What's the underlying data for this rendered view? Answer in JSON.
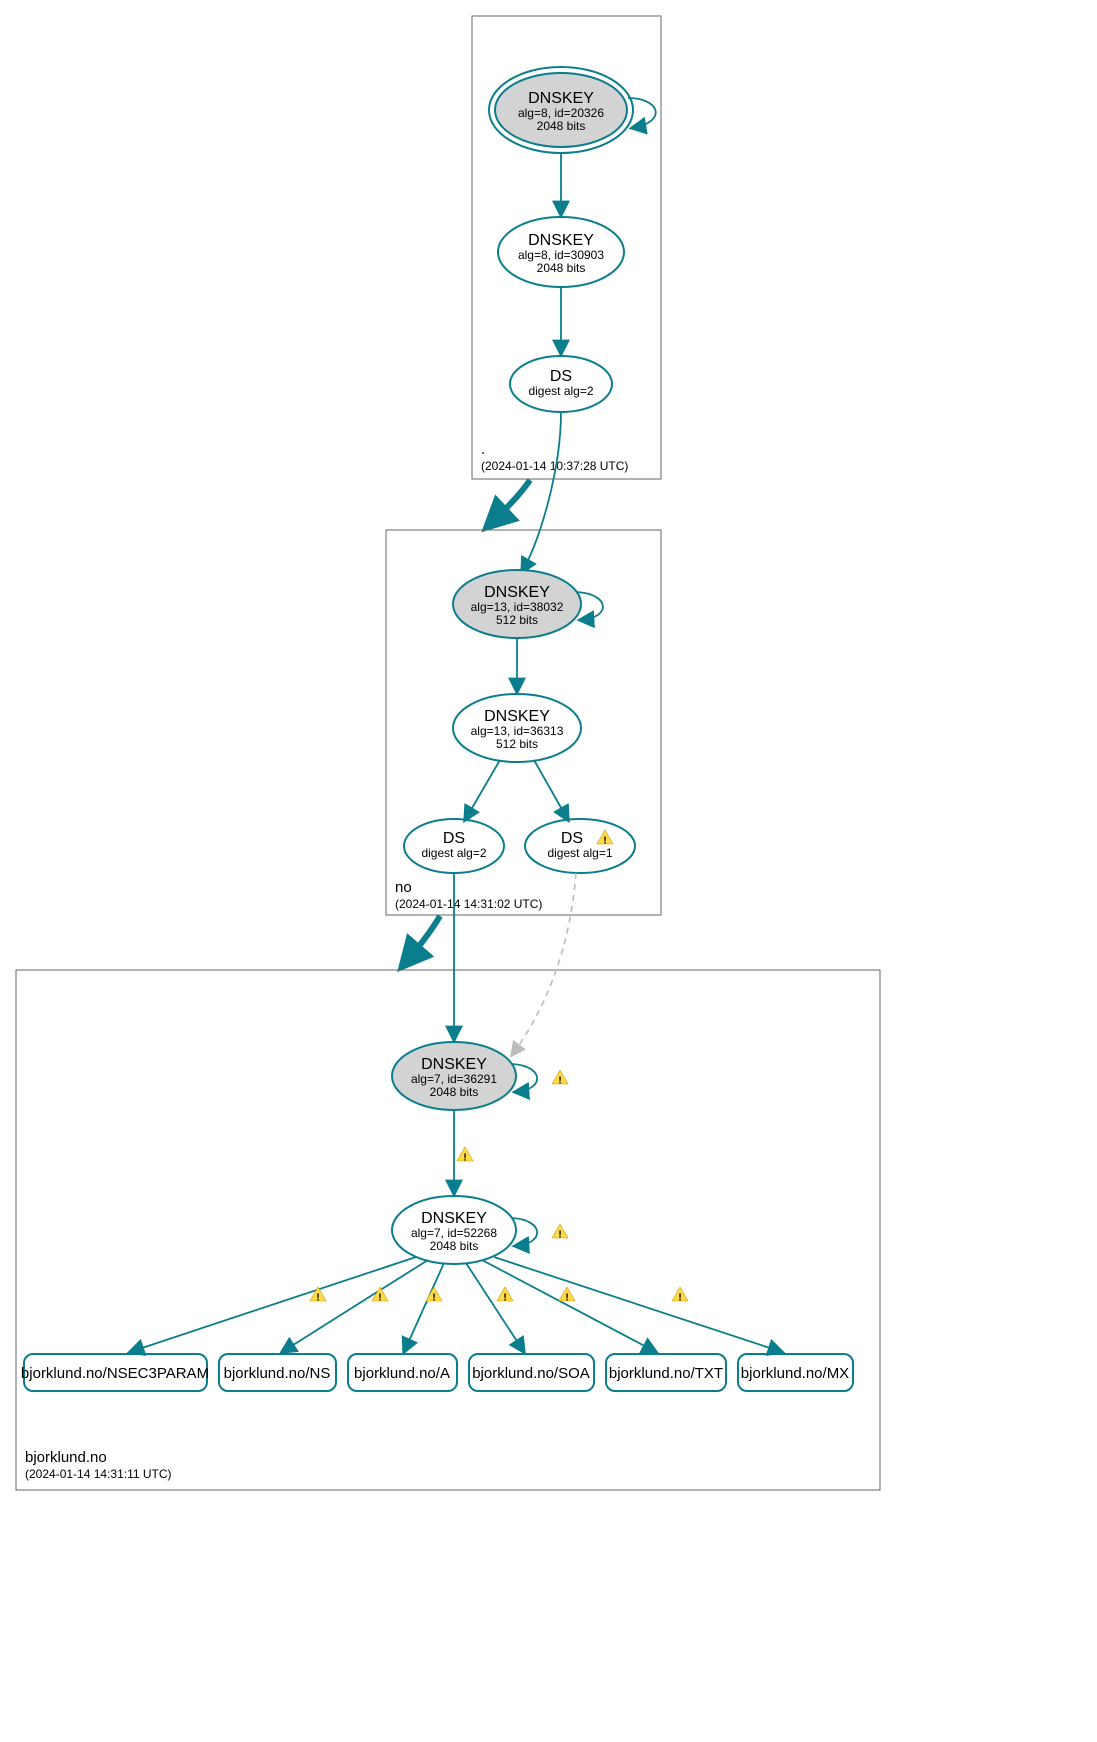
{
  "zones": {
    "root": {
      "label": ".",
      "time": "(2024-01-14 10:37:28 UTC)"
    },
    "no": {
      "label": "no",
      "time": "(2024-01-14 14:31:02 UTC)"
    },
    "leaf": {
      "label": "bjorklund.no",
      "time": "(2024-01-14 14:31:11 UTC)"
    }
  },
  "nodes": {
    "root_ksk": {
      "title": "DNSKEY",
      "l1": "alg=8, id=20326",
      "l2": "2048 bits"
    },
    "root_zsk": {
      "title": "DNSKEY",
      "l1": "alg=8, id=30903",
      "l2": "2048 bits"
    },
    "root_ds": {
      "title": "DS",
      "l1": "digest alg=2",
      "l2": ""
    },
    "no_ksk": {
      "title": "DNSKEY",
      "l1": "alg=13, id=38032",
      "l2": "512 bits"
    },
    "no_zsk": {
      "title": "DNSKEY",
      "l1": "alg=13, id=36313",
      "l2": "512 bits"
    },
    "no_ds1": {
      "title": "DS",
      "l1": "digest alg=2",
      "l2": ""
    },
    "no_ds2": {
      "title": "DS",
      "l1": "digest alg=1",
      "l2": ""
    },
    "leaf_ksk": {
      "title": "DNSKEY",
      "l1": "alg=7, id=36291",
      "l2": "2048 bits"
    },
    "leaf_zsk": {
      "title": "DNSKEY",
      "l1": "alg=7, id=52268",
      "l2": "2048 bits"
    }
  },
  "rr": {
    "r1": "bjorklund.no/NSEC3PARAM",
    "r2": "bjorklund.no/NS",
    "r3": "bjorklund.no/A",
    "r4": "bjorklund.no/SOA",
    "r5": "bjorklund.no/TXT",
    "r6": "bjorklund.no/MX"
  }
}
